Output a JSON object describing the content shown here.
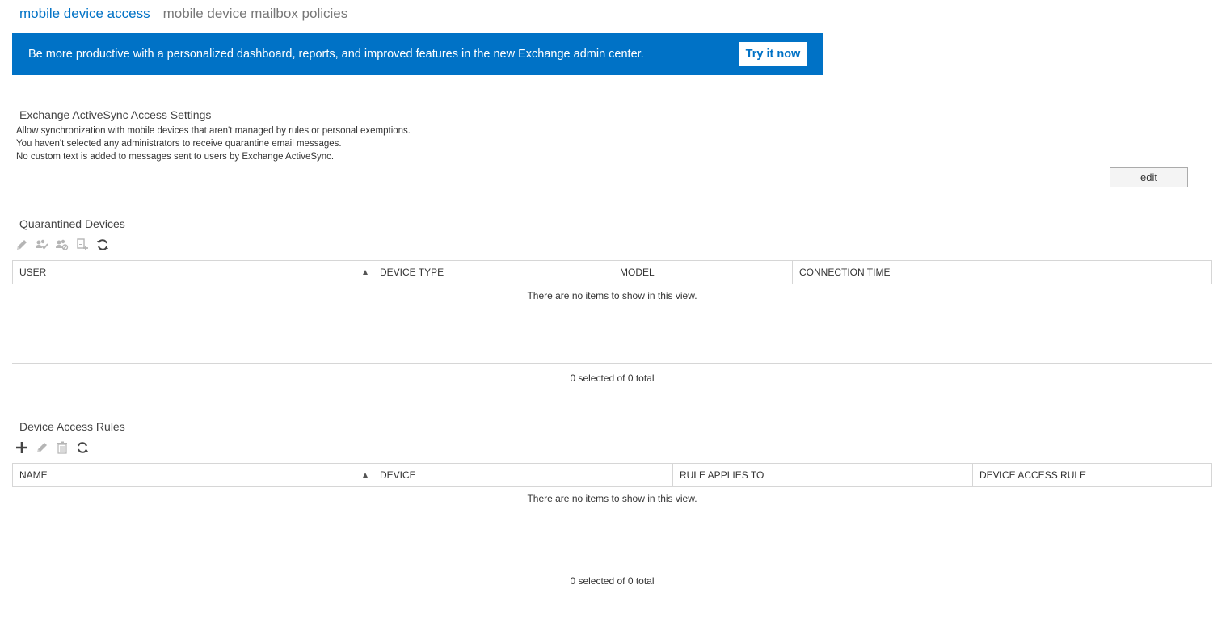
{
  "tabs": [
    {
      "label": "mobile device access",
      "active": true
    },
    {
      "label": "mobile device mailbox policies",
      "active": false
    }
  ],
  "banner": {
    "text": "Be more productive with a personalized dashboard, reports, and improved features in the new Exchange admin center.",
    "button_label": "Try it now",
    "background": "#0072c6"
  },
  "eas_settings": {
    "title": "Exchange ActiveSync Access Settings",
    "lines": [
      "Allow synchronization with mobile devices that aren't managed by rules or personal exemptions.",
      "You haven't selected any administrators to receive quarantine email messages.",
      "No custom text is added to messages sent to users by Exchange ActiveSync."
    ],
    "edit_label": "edit"
  },
  "quarantined": {
    "title": "Quarantined Devices",
    "toolbar": [
      "edit-icon",
      "allow-device-icon",
      "block-device-icon",
      "export-icon",
      "refresh-icon"
    ],
    "columns": [
      "USER",
      "DEVICE TYPE",
      "MODEL",
      "CONNECTION TIME"
    ],
    "sorted_column": "USER",
    "empty_message": "There are no items to show in this view.",
    "footer": "0 selected of 0 total"
  },
  "rules": {
    "title": "Device Access Rules",
    "toolbar": [
      "add-icon",
      "edit-icon",
      "delete-icon",
      "refresh-icon"
    ],
    "columns": [
      "NAME",
      "DEVICE",
      "RULE APPLIES TO",
      "DEVICE ACCESS RULE"
    ],
    "sorted_column": "NAME",
    "empty_message": "There are no items to show in this view.",
    "footer": "0 selected of 0 total"
  },
  "colors": {
    "accent": "#0072c6",
    "disabled_icon": "#b5b5b5",
    "enabled_icon": "#444444"
  }
}
